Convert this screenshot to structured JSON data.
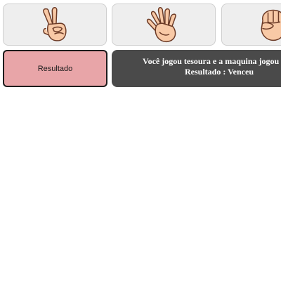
{
  "choices": [
    {
      "name": "tesoura",
      "icon": "scissors-hand-icon"
    },
    {
      "name": "papel",
      "icon": "open-hand-icon"
    },
    {
      "name": "pedra",
      "icon": "fist-hand-icon"
    }
  ],
  "result": {
    "label": "Resultado",
    "message": "Você jogou tesoura e a maquina jogou pa",
    "status": "Resultado : Venceu"
  },
  "colors": {
    "choice_bg": "#eeeeee",
    "label_bg": "#e8a5a8",
    "result_bg": "#4a4a4a",
    "skin": "#f8c9a6",
    "outline": "#6b3a26"
  }
}
